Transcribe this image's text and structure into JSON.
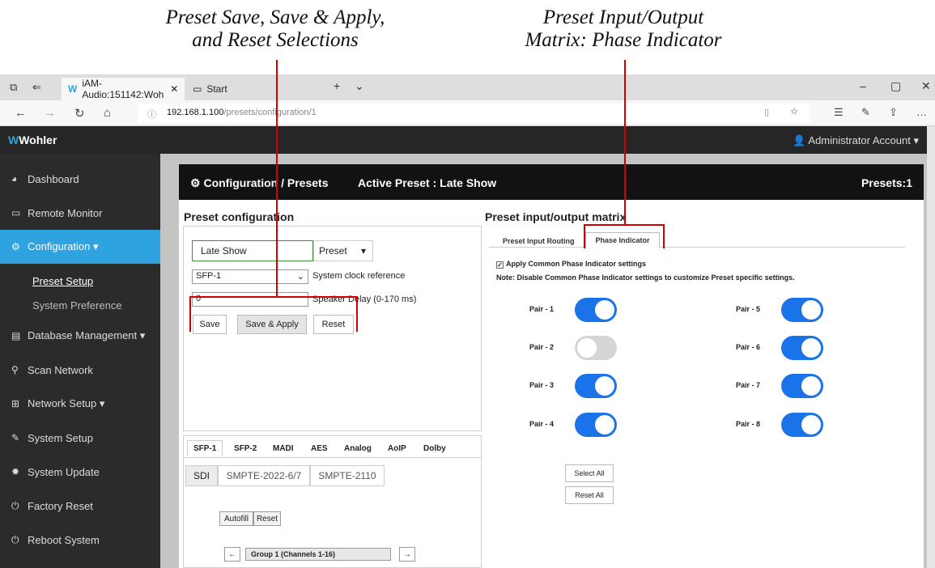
{
  "callouts": {
    "left_line1": "Preset Save, Save & Apply,",
    "left_line2": "and Reset Selections",
    "right_line1": "Preset Input/Output",
    "right_line2": "Matrix: Phase Indicator",
    "color": "#d40000"
  },
  "browser": {
    "tabs": [
      {
        "label": "iAM-Audio:151142:Woh",
        "icon": "wohler-w-icon"
      },
      {
        "label": "Start",
        "icon": "start-page-icon"
      }
    ],
    "url_host": "192.168.1.100",
    "url_path": "/presets/configuration/1"
  },
  "app": {
    "brand": "Wohler",
    "account": "Administrator Account ▾",
    "accent": "#2ea3df"
  },
  "sidebar": {
    "items": [
      {
        "label": "Dashboard",
        "icon": "dashboard-icon"
      },
      {
        "label": "Remote Monitor",
        "icon": "monitor-icon"
      },
      {
        "label": "Configuration ▾",
        "icon": "cogs-icon"
      },
      {
        "label": "Preset Setup"
      },
      {
        "label": "System Preference"
      },
      {
        "label": "Database Management ▾",
        "icon": "database-icon"
      },
      {
        "label": "Scan Network",
        "icon": "search-icon"
      },
      {
        "label": "Network Setup ▾",
        "icon": "sitemap-icon"
      },
      {
        "label": "System Setup",
        "icon": "wrench-icon"
      },
      {
        "label": "System Update",
        "icon": "gear-icon"
      },
      {
        "label": "Factory Reset",
        "icon": "power-icon"
      },
      {
        "label": "Reboot System",
        "icon": "power-icon"
      }
    ]
  },
  "panel": {
    "title": "Configuration / Presets",
    "active_preset": "Active Preset : Late Show",
    "presets_count": "Presets:1"
  },
  "preset_config": {
    "title": "Preset configuration",
    "name_value": "Late Show",
    "preset_select": "Preset",
    "clock_value": "SFP-1",
    "clock_label": "System clock reference",
    "delay_value": "0",
    "delay_label": "Speaker Delay (0-170 ms)",
    "save": "Save",
    "save_apply": "Save & Apply",
    "reset": "Reset"
  },
  "interfaces": {
    "tabs": [
      "SFP-1",
      "SFP-2",
      "MADI",
      "AES",
      "Analog",
      "AoIP",
      "Dolby"
    ],
    "pills": [
      "SDI",
      "SMPTE-2022-6/7",
      "SMPTE-2110"
    ],
    "autofill": "Autofill",
    "reset": "Reset",
    "group": "Group 1 (Channels 1-16)"
  },
  "matrix": {
    "title": "Preset input/output matrix",
    "tab_routing": "Preset Input Routing",
    "tab_phase": "Phase Indicator",
    "apply_common": "Apply Common Phase Indicator settings",
    "note": "Note: Disable Common Phase Indicator settings to customize Preset specific settings.",
    "pairs": [
      {
        "label": "Pair - 1",
        "on": true
      },
      {
        "label": "Pair - 2",
        "on": false
      },
      {
        "label": "Pair - 3",
        "on": true
      },
      {
        "label": "Pair - 4",
        "on": true
      },
      {
        "label": "Pair - 5",
        "on": true
      },
      {
        "label": "Pair - 6",
        "on": true
      },
      {
        "label": "Pair - 7",
        "on": true
      },
      {
        "label": "Pair - 8",
        "on": true
      }
    ],
    "select_all": "Select All",
    "reset_all": "Reset All",
    "toggle_on_color": "#1a73e8"
  }
}
